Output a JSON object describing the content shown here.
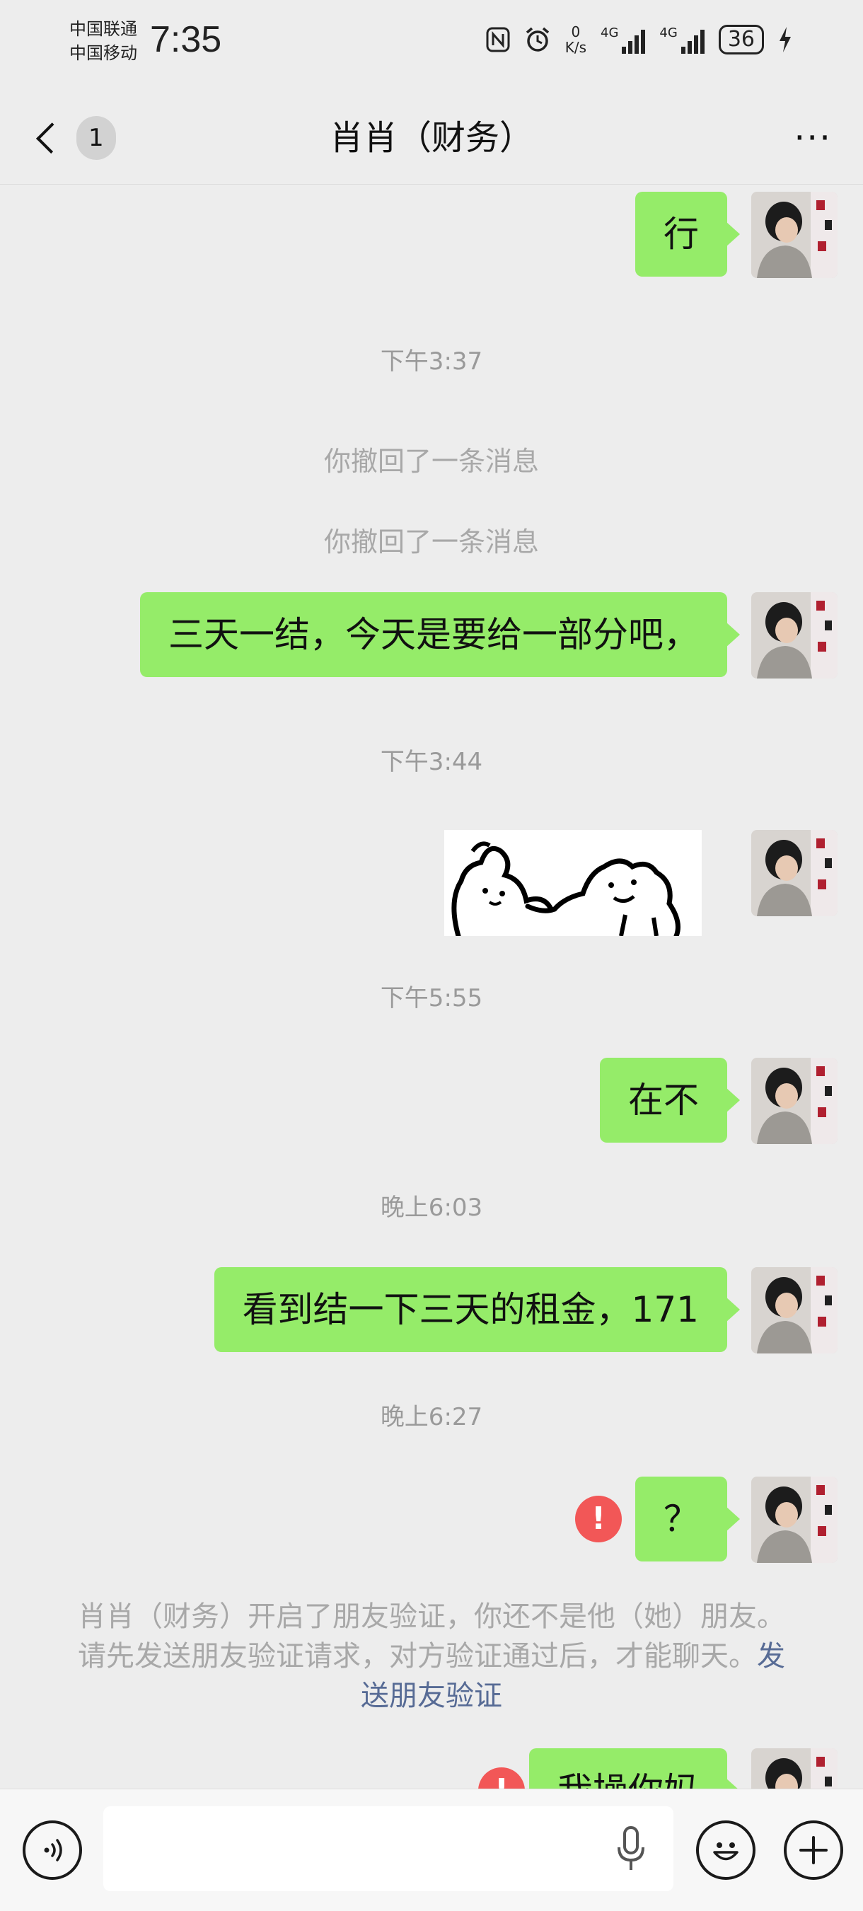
{
  "status_bar": {
    "carrier_1": "中国联通",
    "carrier_2": "中国移动",
    "time": "7:35",
    "net_speed_value": "0",
    "net_speed_unit": "K/s",
    "signal_1_label": "4G",
    "signal_2_label": "4G",
    "battery": "36",
    "icons": [
      "nfc-icon",
      "alarm-icon",
      "signal-icon",
      "battery-icon",
      "charging-icon"
    ]
  },
  "header": {
    "back_badge": "1",
    "title": "肖肖（财务）",
    "more_label": "···"
  },
  "messages": {
    "m1": "行",
    "t1": "下午3:37",
    "recall1": "你撤回了一条消息",
    "recall2": "你撤回了一条消息",
    "m2": "三天一结，今天是要给一部分吧，",
    "t2": "下午3:44",
    "t3": "下午5:55",
    "m3": "在不",
    "t4": "晚上6:03",
    "m4": "看到结一下三天的租金，171",
    "t5": "晚上6:27",
    "m5": "？",
    "failed_mark": "!",
    "notice_text": "肖肖（财务）开启了朋友验证，你还不是他（她）朋友。请先发送朋友验证请求，对方验证通过后，才能聊天。",
    "notice_link": "发送朋友验证",
    "m6_partial": "我操你妈"
  },
  "input_bar": {
    "placeholder": "",
    "icons": [
      "voice-icon",
      "microphone-icon",
      "emoji-icon",
      "plus-icon"
    ]
  },
  "colors": {
    "background": "#ededed",
    "bubble_green": "#95ec69",
    "link_blue": "#576b95",
    "error_red": "#f25757",
    "system_gray": "#a8a8a8"
  }
}
